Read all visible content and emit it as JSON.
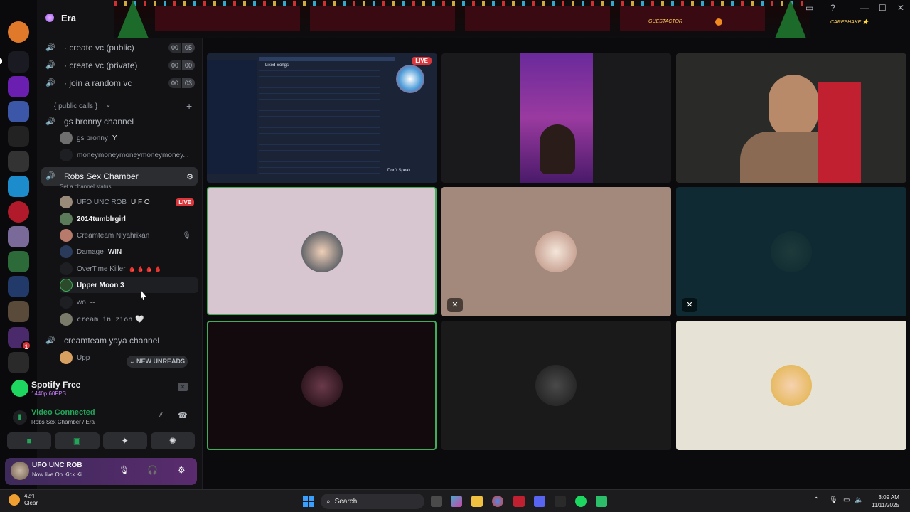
{
  "server": {
    "name": "Era",
    "rail_badge": "1"
  },
  "channels": [
    {
      "name": "· create vc (public)",
      "count_a": "00",
      "count_b": "05"
    },
    {
      "name": "· create vc (private)",
      "count_a": "00",
      "count_b": "00"
    },
    {
      "name": "· join a random vc",
      "count_a": "00",
      "count_b": "03"
    }
  ],
  "category": {
    "label": "{ public calls }",
    "chevron": "⌄",
    "add": "+"
  },
  "gs_channel": {
    "name": "gs bronny channel",
    "users": [
      "gs bronny",
      "moneymoneymoneymoneymoney..."
    ],
    "user_tag": "Y"
  },
  "active_channel": {
    "name": "Robs Sex Chamber",
    "status": "Set a channel status",
    "users": [
      {
        "name": "UFO UNC ROB",
        "extra": "U F O",
        "live": "LIVE",
        "bold": false
      },
      {
        "name": "2014tumblrgirl",
        "extra": "",
        "live": "",
        "bold": true
      },
      {
        "name": "Creamteam Niyahrixan",
        "extra": "",
        "live": "",
        "bold": false
      },
      {
        "name": "Damage",
        "extra": "WIN",
        "live": "",
        "bold": false
      },
      {
        "name": "OverTime Killer",
        "extra": "🩸 🩸 🩸 🩸",
        "live": "",
        "bold": false
      },
      {
        "name": "Upper Moon 3",
        "extra": "",
        "live": "",
        "bold": true
      },
      {
        "name": "wo",
        "extra": "--",
        "live": "",
        "bold": false
      },
      {
        "name": "cream in zion",
        "extra": "🤍",
        "live": "",
        "bold": false
      }
    ]
  },
  "creamteam_channel": {
    "name": "creamteam yaya channel",
    "first_user": "Upp"
  },
  "new_unreads": "⌄ NEW UNREADS",
  "activity": {
    "title": "Spotify Free",
    "sub": "1440p 60FPS"
  },
  "voice": {
    "status": "Video Connected",
    "location": "Robs Sex Chamber / Era"
  },
  "me": {
    "name": "UFO UNC ROB",
    "status": "Now live On Kick Ki..."
  },
  "banner": {
    "tag1": "GUESTACTOR",
    "tag2": "CARESHAKE ⭐"
  },
  "stream": {
    "live": "LIVE",
    "caption": "Don't Speak",
    "header": "Liked Songs"
  },
  "taskbar": {
    "temp": "42°F",
    "weather": "Clear",
    "search": "Search",
    "time": "3:09 AM",
    "date": "11/11/2025"
  },
  "icons": {
    "speaker": "🔊",
    "gear": "⚙",
    "mic_off": "🎙",
    "hangup": "☎",
    "headphones": "🎧",
    "search": "🔍",
    "window_min": "—",
    "window_max": "☐",
    "window_close": "✕",
    "help": "?",
    "inbox": "▭"
  }
}
